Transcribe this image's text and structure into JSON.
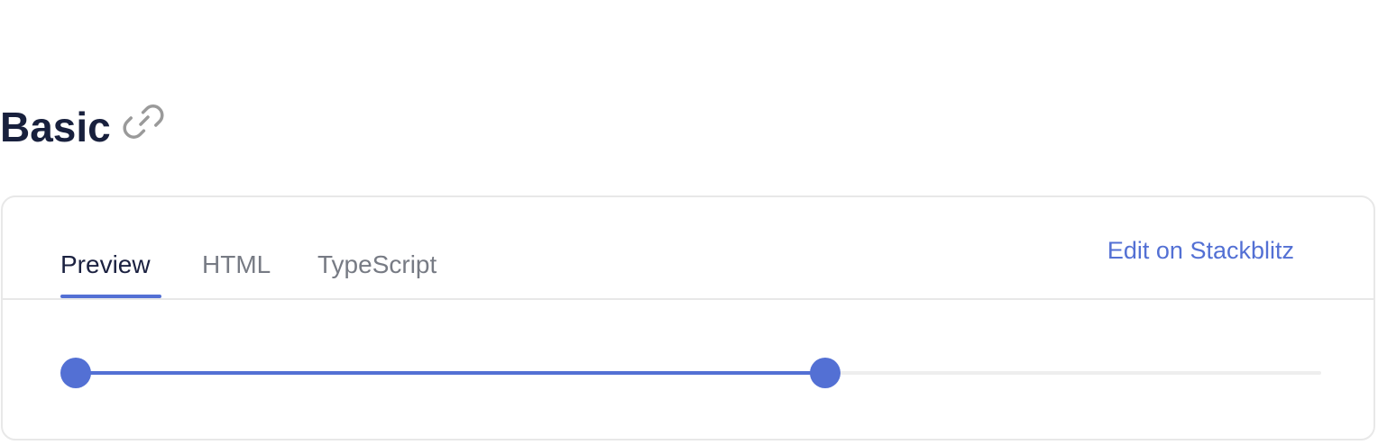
{
  "section": {
    "title": "Basic",
    "anchor_icon": "link-icon"
  },
  "tabs": [
    {
      "label": "Preview",
      "active": true
    },
    {
      "label": "HTML",
      "active": false
    },
    {
      "label": "TypeScript",
      "active": false
    }
  ],
  "actions": {
    "edit_label": "Edit on Stackblitz"
  },
  "slider": {
    "fill_fraction": 0.6,
    "start_fraction": 0,
    "end_fraction": 0.6
  },
  "colors": {
    "accent": "#5370d4",
    "heading": "#18203d",
    "muted": "#777b84",
    "border": "#e8e8e8",
    "track": "#eeeeee",
    "icon": "#9a9a9a"
  }
}
